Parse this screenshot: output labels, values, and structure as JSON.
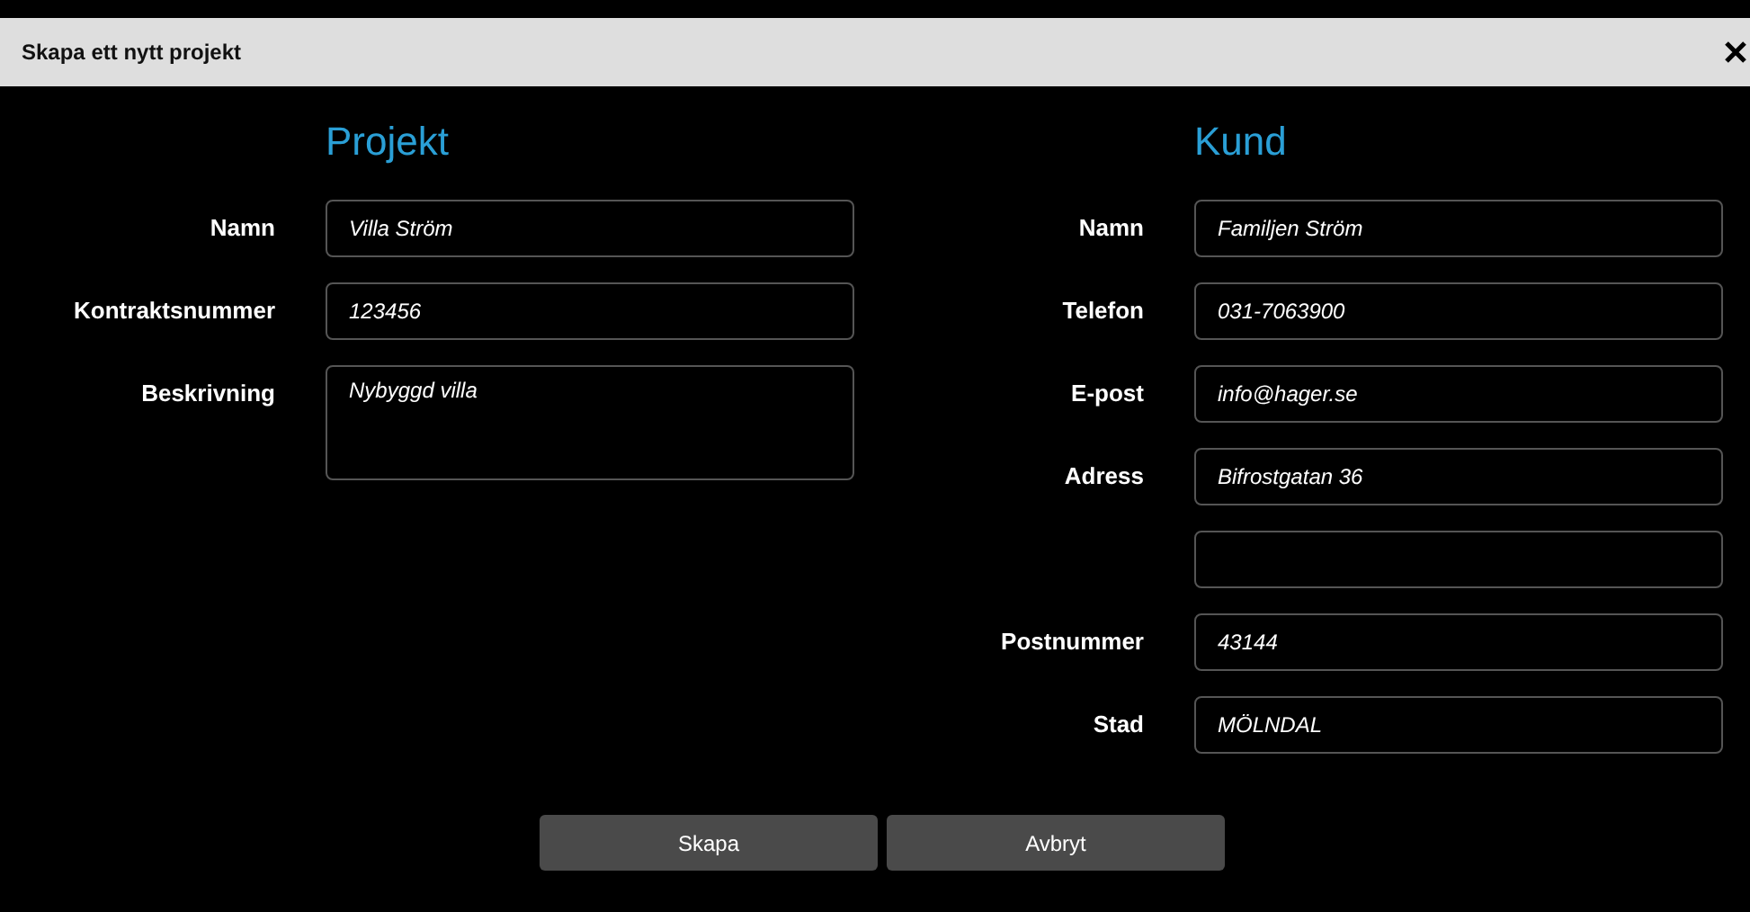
{
  "dialog": {
    "title": "Skapa ett nytt projekt"
  },
  "project": {
    "heading": "Projekt",
    "fields": [
      {
        "label": "Namn",
        "value": "Villa Ström",
        "kind": "text"
      },
      {
        "label": "Kontraktsnummer",
        "value": "123456",
        "kind": "text"
      },
      {
        "label": "Beskrivning",
        "value": "Nybyggd villa",
        "kind": "multiline"
      }
    ]
  },
  "customer": {
    "heading": "Kund",
    "fields": [
      {
        "label": "Namn",
        "value": "Familjen Ström",
        "kind": "text"
      },
      {
        "label": "Telefon",
        "value": "031-7063900",
        "kind": "text"
      },
      {
        "label": "E-post",
        "value": "info@hager.se",
        "kind": "text"
      },
      {
        "label": "Adress",
        "value": "Bifrostgatan 36",
        "kind": "text"
      },
      {
        "kind": "text"
      },
      {
        "label": "Postnummer",
        "value": "43144",
        "kind": "text"
      },
      {
        "label": "Stad",
        "value": "MÖLNDAL",
        "kind": "text"
      }
    ]
  },
  "buttons": [
    "Skapa",
    "Avbryt"
  ]
}
